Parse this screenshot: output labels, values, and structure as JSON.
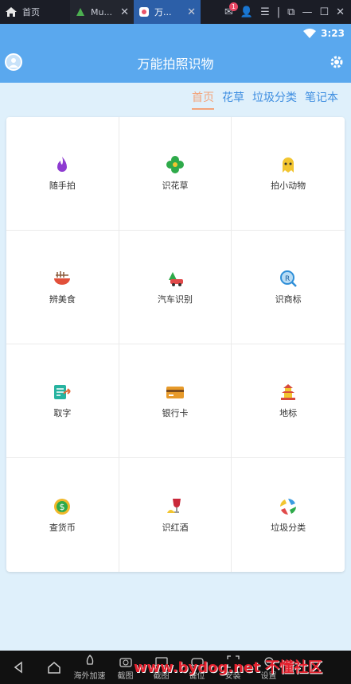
{
  "emulator": {
    "tabs": [
      {
        "label": "首页",
        "icon": "home-icon"
      },
      {
        "label": "Mu...",
        "icon": "app-icon"
      },
      {
        "label": "万...",
        "icon": "app-icon"
      }
    ],
    "notification_count": "1"
  },
  "status_bar": {
    "time": "3:23"
  },
  "header": {
    "title": "万能拍照识物"
  },
  "tabs": [
    "首页",
    "花草",
    "垃圾分类",
    "笔记本"
  ],
  "grid": [
    {
      "label": "随手拍",
      "icon": "flame-icon",
      "color": "#8e3bd1"
    },
    {
      "label": "识花草",
      "icon": "flower-icon",
      "color": "#2eaa4a"
    },
    {
      "label": "拍小动物",
      "icon": "ghost-icon",
      "color": "#f2c530"
    },
    {
      "label": "辨美食",
      "icon": "noodle-bowl-icon",
      "color": "#e2503a"
    },
    {
      "label": "汽车识别",
      "icon": "car-icon",
      "color": "#e14a4a"
    },
    {
      "label": "识商标",
      "icon": "trademark-icon",
      "color": "#2f8fd8"
    },
    {
      "label": "取字",
      "icon": "ocr-icon",
      "color": "#27b3a0"
    },
    {
      "label": "银行卡",
      "icon": "bank-card-icon",
      "color": "#e79a2a"
    },
    {
      "label": "地标",
      "icon": "pagoda-icon",
      "color": "#d84b3c"
    },
    {
      "label": "查货币",
      "icon": "coin-icon",
      "color": "#f0b82a"
    },
    {
      "label": "识红酒",
      "icon": "wine-icon",
      "color": "#c9283a"
    },
    {
      "label": "垃圾分类",
      "icon": "recycle-icon",
      "color": "#3b9be0"
    }
  ],
  "navbar": {
    "items": [
      "海外加速",
      "截图",
      "截图",
      "键位",
      "安装",
      "设置"
    ],
    "watermark": "www.bydog.net 不懂社区"
  }
}
